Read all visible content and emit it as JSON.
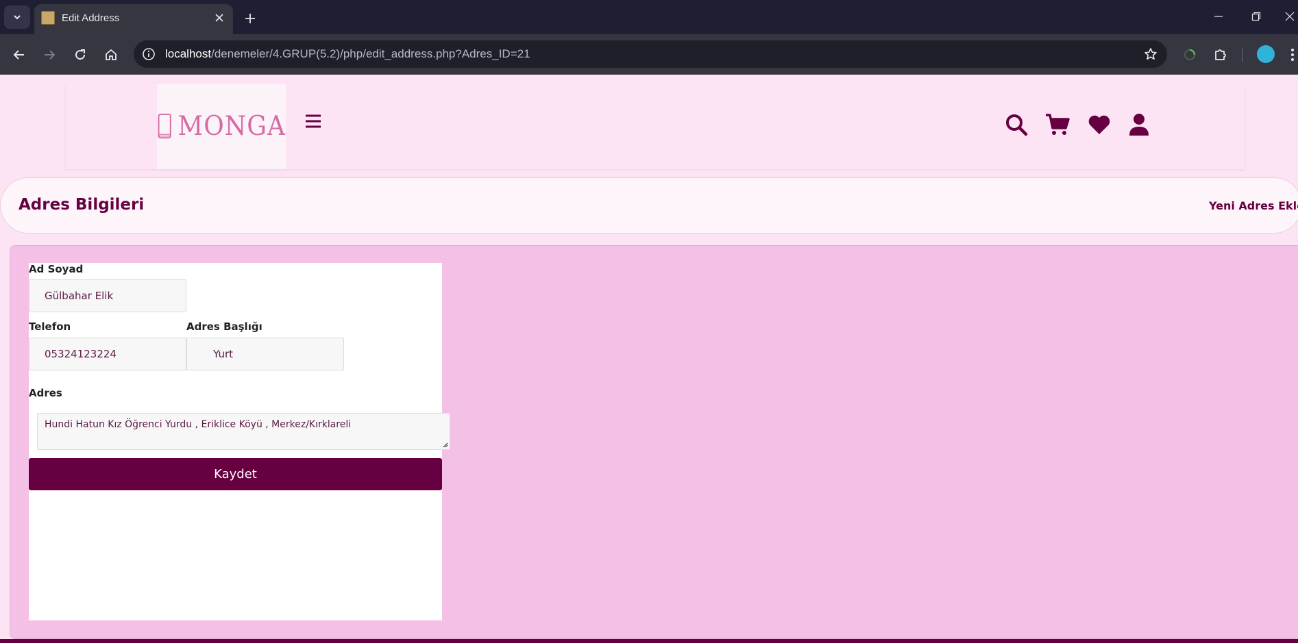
{
  "browser": {
    "tab_title": "Edit Address",
    "url_host": "localhost",
    "url_path": "/denemeler/4.GRUP(5.2)/php/edit_address.php?Adres_ID=21"
  },
  "site": {
    "logo_text": "MONGA",
    "brand_color": "#660041",
    "accent_color": "#d56aa5"
  },
  "address_bar": {
    "title": "Adres Bilgileri",
    "new_address_link": "Yeni Adres Ekle"
  },
  "form": {
    "name_label": "Ad Soyad",
    "name_value": "Gülbahar Elik",
    "phone_label": "Telefon",
    "phone_value": "05324123224",
    "address_title_label": "Adres Başlığı",
    "address_title_value": "Yurt",
    "address_label": "Adres",
    "address_value": "Hundi Hatun Kız Öğrenci Yurdu , Eriklice Köyü , Merkez/Kırklareli",
    "save_label": "Kaydet"
  },
  "icons": {
    "header": [
      "search-icon",
      "cart-icon",
      "heart-icon",
      "user-icon"
    ],
    "menu": "hamburger-icon"
  }
}
